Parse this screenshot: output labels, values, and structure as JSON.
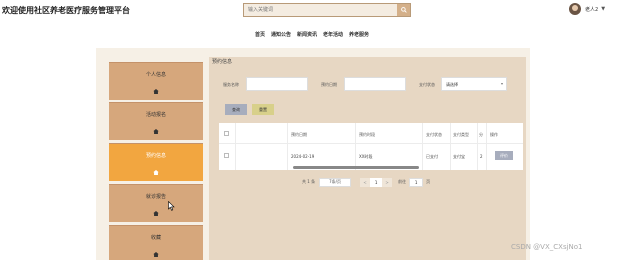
{
  "header": {
    "title": "欢迎使用社区养老医疗服务管理平台",
    "search_placeholder": "输入关键词",
    "search_icon": "search-icon",
    "user_name": "老人2",
    "user_caret": "▼"
  },
  "nav": [
    "首页",
    "通知公告",
    "新闻资讯",
    "老年活动",
    "养老服务"
  ],
  "sidebar": {
    "items": [
      {
        "label": "个人信息",
        "active": false
      },
      {
        "label": "活动报名",
        "active": false
      },
      {
        "label": "预约信息",
        "active": true
      },
      {
        "label": "就诊报告",
        "active": false
      },
      {
        "label": "收藏",
        "active": false
      }
    ],
    "item_icon": "home-icon"
  },
  "main": {
    "breadcrumb": "预约信息",
    "filters": {
      "service_name_label": "服务名称",
      "service_name_value": "",
      "date_label": "预约日期",
      "date_value": "",
      "status_label": "支付状态",
      "status_value": "请选择"
    },
    "buttons": {
      "query": "查询",
      "reset": "重置"
    },
    "table": {
      "columns": [
        "",
        "",
        "预约日期",
        "预约时段",
        "支付状态",
        "支付类型",
        "分",
        "操作"
      ],
      "rows": [
        {
          "c0": "",
          "c1": "",
          "date": "2024-02-19",
          "period": "XX时段",
          "pay_status": "已支付",
          "pay_type": "支付宝",
          "score": "2",
          "action": "评价"
        }
      ]
    },
    "pager": {
      "total": "共 1 条",
      "page_size": "7条/页",
      "prev": "<",
      "current": "1",
      "next": ">",
      "goto_label": "前往",
      "goto_value": "1",
      "page_unit": "页"
    }
  },
  "watermark": "CSDN @VX_CXsjNo1",
  "colors": {
    "accent": "#f2a640",
    "sidebar_bg": "#d6a77c",
    "main_bg": "#e7d7c3",
    "btn_query": "#a7adbd",
    "btn_reset": "#d8d08a"
  }
}
